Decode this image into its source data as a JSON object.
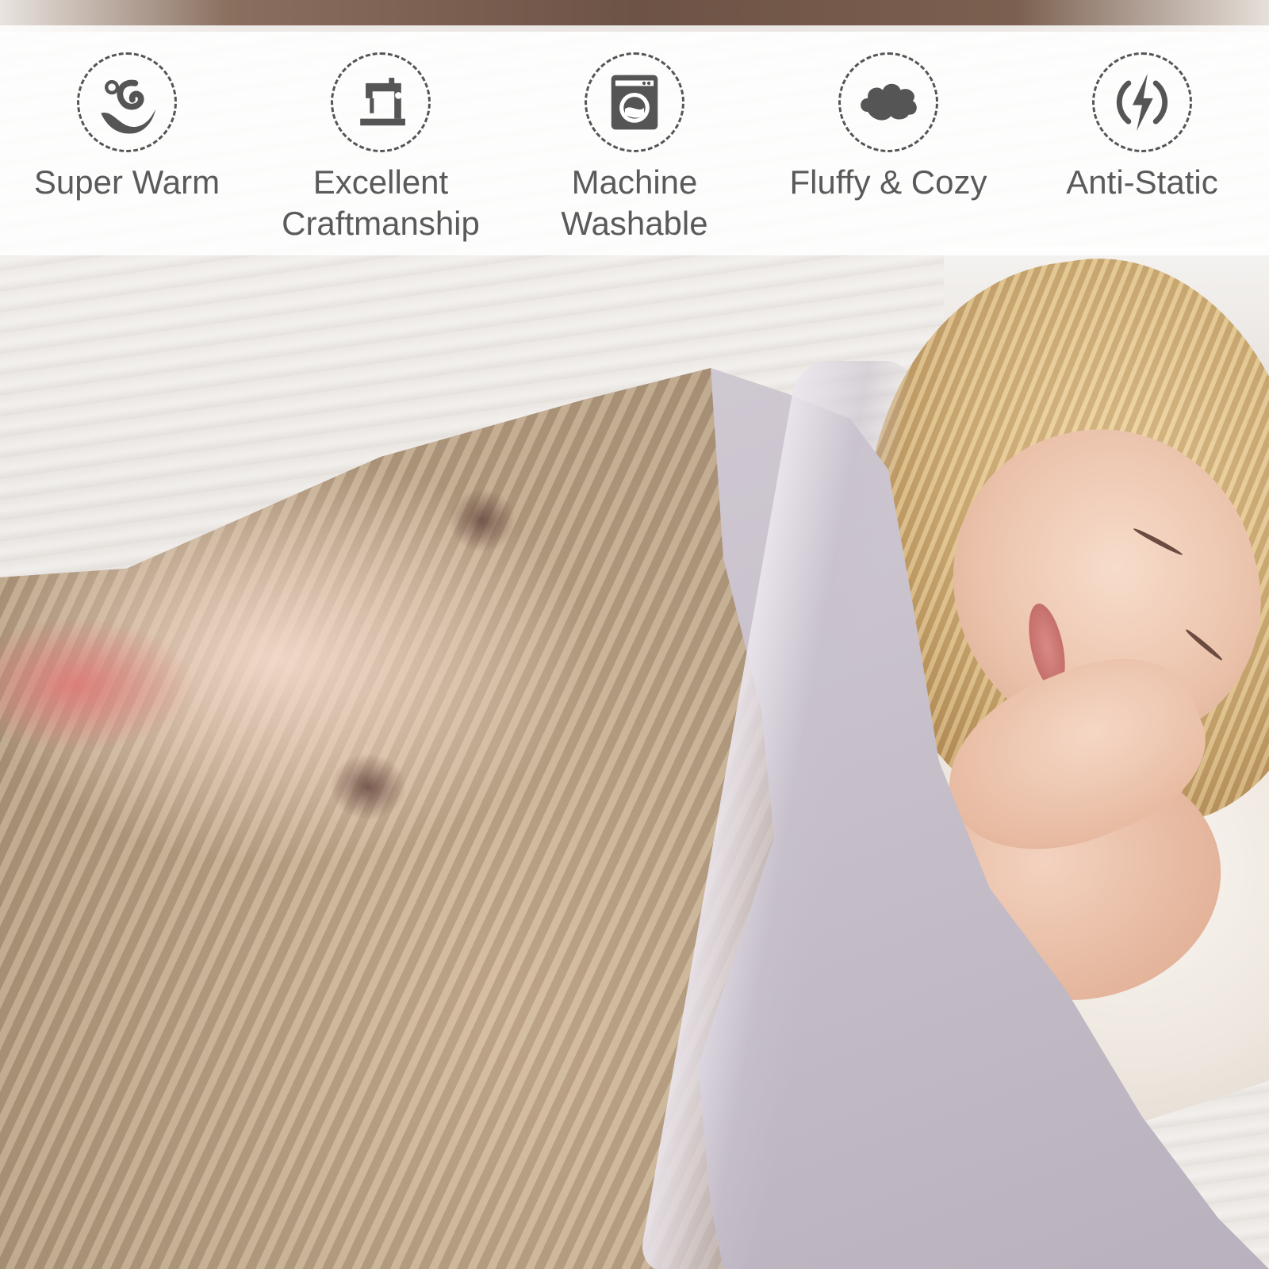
{
  "features": [
    {
      "icon": "warmth-swirl-icon",
      "label": "Super Warm"
    },
    {
      "icon": "sewing-machine-icon",
      "label": "Excellent\nCraftmanship"
    },
    {
      "icon": "washing-machine-icon",
      "label": "Machine\nWashable"
    },
    {
      "icon": "cloud-icon",
      "label": "Fluffy & Cozy"
    },
    {
      "icon": "lightning-bolt-icon",
      "label": "Anti-Static"
    }
  ],
  "colors": {
    "icon": "#555555",
    "label": "#5a5a5a",
    "banner": "#ffffff"
  }
}
